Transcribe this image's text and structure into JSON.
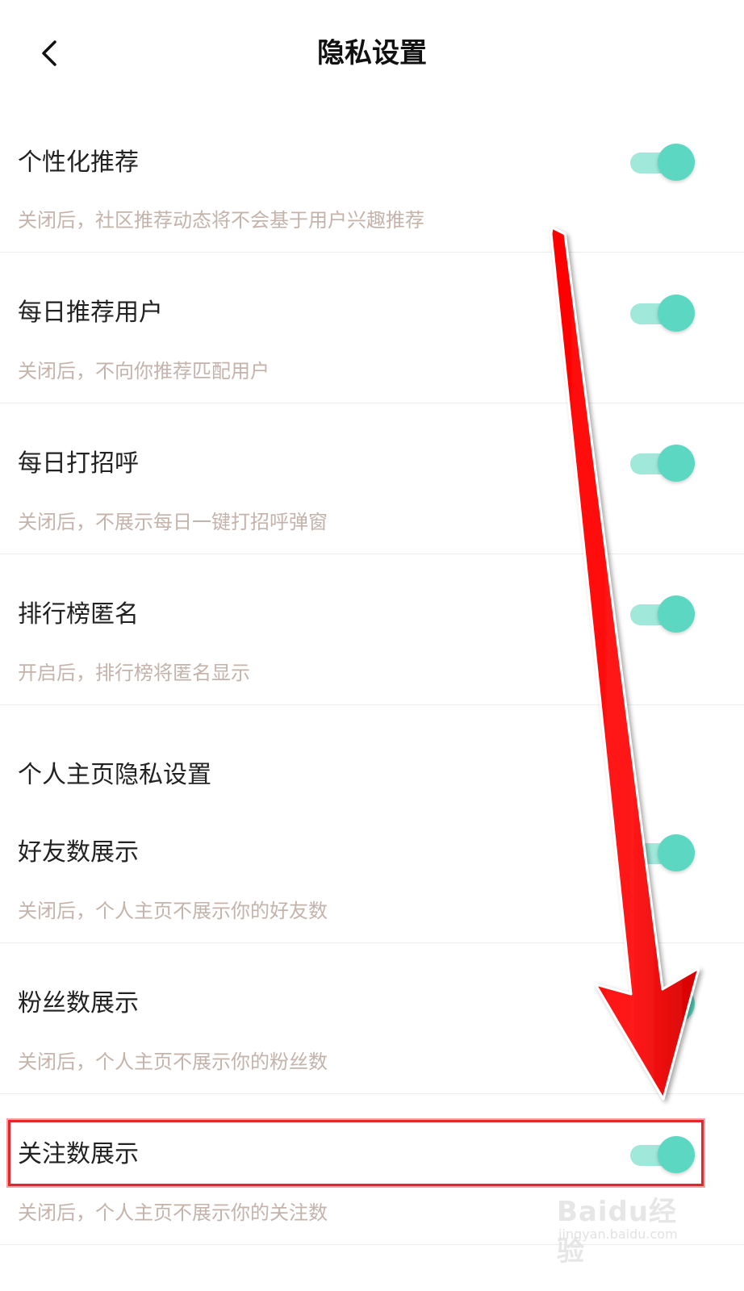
{
  "header": {
    "title": "隐私设置"
  },
  "rows": [
    {
      "label": "个性化推荐",
      "desc": "关闭后，社区推荐动态将不会基于用户兴趣推荐",
      "on": true
    },
    {
      "label": "每日推荐用户",
      "desc": "关闭后，不向你推荐匹配用户",
      "on": true
    },
    {
      "label": "每日打招呼",
      "desc": "关闭后，不展示每日一键打招呼弹窗",
      "on": true
    },
    {
      "label": "排行榜匿名",
      "desc": "开启后，排行榜将匿名显示",
      "on": true
    }
  ],
  "profile_section": {
    "title": "个人主页隐私设置",
    "rows": [
      {
        "label": "好友数展示",
        "desc": "关闭后，个人主页不展示你的好友数",
        "on": true
      },
      {
        "label": "粉丝数展示",
        "desc": "关闭后，个人主页不展示你的粉丝数",
        "on": true
      },
      {
        "label": "关注数展示",
        "desc": "关闭后，个人主页不展示你的关注数",
        "on": true
      }
    ]
  },
  "colors": {
    "toggle_track": "#9fe8da",
    "toggle_knob": "#5cd8c2",
    "desc_text": "#c4b3ab",
    "annotation_red": "#ff0000"
  },
  "watermark": {
    "logo": "Baidu经验",
    "url": "jingyan.baidu.com"
  }
}
